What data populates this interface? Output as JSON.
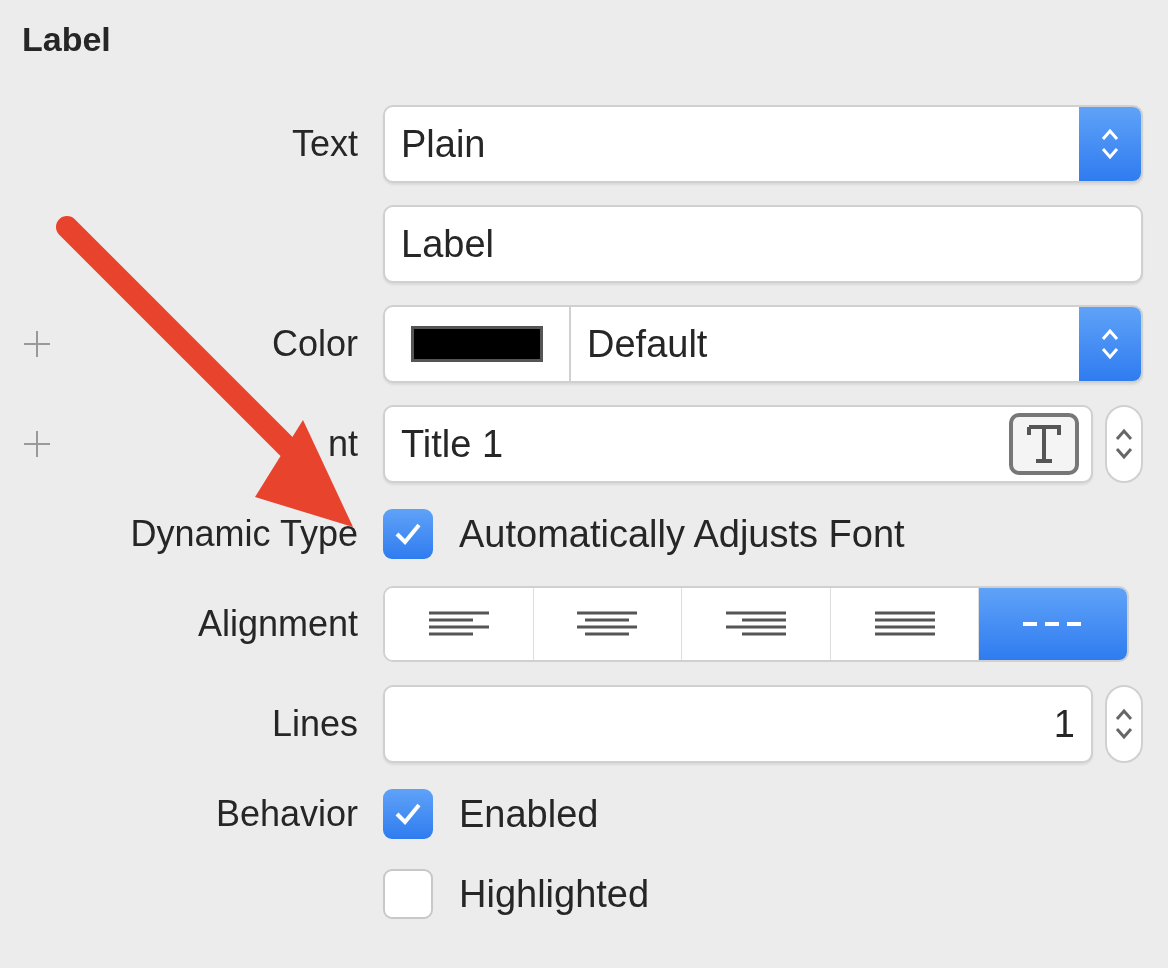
{
  "panel_title": "Label",
  "rows": [
    {
      "kind": "popup",
      "label": "Text",
      "value": "Plain"
    },
    {
      "kind": "field",
      "value": "Label"
    },
    {
      "kind": "color",
      "label": "Color",
      "value": "Default",
      "has_plus": true,
      "color": "#000000"
    },
    {
      "kind": "font",
      "label": "nt",
      "value": "Title 1",
      "has_plus": true
    },
    {
      "kind": "checkbox",
      "label": "Dynamic Type",
      "text": "Automatically Adjusts Font",
      "checked": true
    },
    {
      "kind": "segmented",
      "label": "Alignment",
      "segments": [
        {
          "kind": "left",
          "selected": false
        },
        {
          "kind": "center",
          "selected": false
        },
        {
          "kind": "right",
          "selected": false
        },
        {
          "kind": "justified",
          "selected": false
        },
        {
          "kind": "natural",
          "selected": true
        }
      ]
    },
    {
      "kind": "stepper",
      "label": "Lines",
      "value": "1"
    },
    {
      "kind": "checkbox",
      "label": "Behavior",
      "text": "Enabled",
      "checked": true
    },
    {
      "kind": "checkbox",
      "text": "Highlighted",
      "checked": false
    }
  ]
}
